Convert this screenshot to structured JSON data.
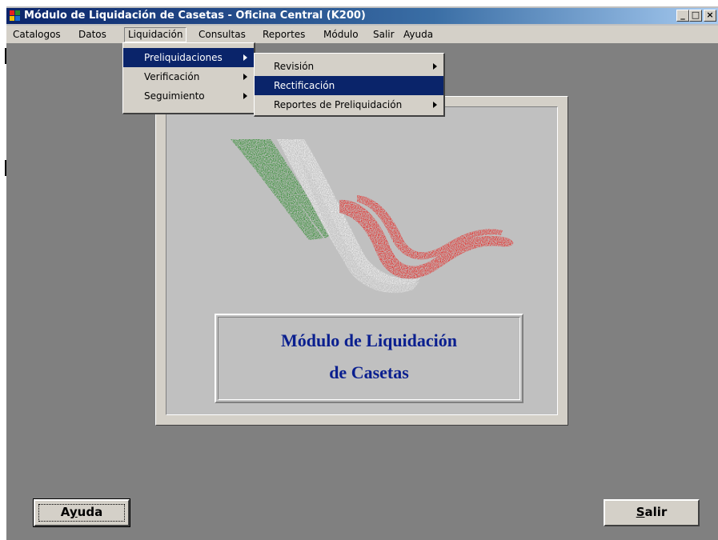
{
  "window": {
    "title": "Módulo de Liquidación de Casetas - Oficina Central (K200)",
    "controls": {
      "minimize": "_",
      "maximize": "□",
      "close": "×"
    }
  },
  "menubar": {
    "items": [
      "Catalogos",
      "Datos",
      "Liquidación",
      "Consultas",
      "Reportes",
      "Módulo",
      "Salir",
      "Ayuda"
    ],
    "open_item": "Liquidación"
  },
  "liquidacion_menu": {
    "items": [
      "Preliquidaciones",
      "Verificación",
      "Seguimiento"
    ],
    "selected": "Preliquidaciones"
  },
  "preliquidaciones_submenu": {
    "items": [
      "Revisión",
      "Rectificación",
      "Reportes de Preliquidación"
    ],
    "selected": "Rectificación"
  },
  "splash": {
    "title_line1": "Módulo de Liquidación",
    "title_line2": "de Casetas",
    "logo": "mexico-flag-ribbon-logo",
    "colors": {
      "green": "#2a8a2a",
      "white": "#f2f2f2",
      "red": "#e8201c",
      "title": "#0a1f8f"
    }
  },
  "buttons": {
    "ayuda_pre": "A",
    "ayuda_u": "y",
    "ayuda_post": "uda",
    "salir_u": "S",
    "salir_post": "alir"
  }
}
